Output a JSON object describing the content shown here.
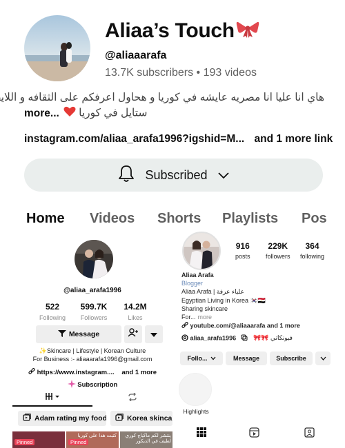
{
  "youtube": {
    "channel_name": "Aliaa’s Touch",
    "handle": "@aliaaarafa",
    "subscribers": "13.7K subscribers",
    "separator": "•",
    "videos": "193 videos",
    "description_line1": "هاي انا عليا انا مصريه عايشه في كوريا و هحاول اعرفكم على الثقافه و اللايف",
    "description_more": "more...",
    "description_line2": "ستايل في كوريا",
    "link_text": "instagram.com/aliaa_arafa1996?igshid=M...",
    "more_links": "and 1 more link",
    "subscribed_label": "Subscribed",
    "tabs": [
      "Home",
      "Videos",
      "Shorts",
      "Playlists",
      "Pos"
    ]
  },
  "tiktok": {
    "handle": "@aliaa_arafa1996",
    "stats": [
      {
        "value": "522",
        "label": "Following"
      },
      {
        "value": "599.7K",
        "label": "Followers"
      },
      {
        "value": "14.2M",
        "label": "Likes"
      }
    ],
    "message_label": "Message",
    "bio_line1": "✨Skincare | Lifestyle | Korean Culture",
    "bio_line2": "For Business :- aliaaarafa1996@gmail.com",
    "link": "https://www.instagram....",
    "more_links": "and 1 more",
    "subscription_label": "Subscription",
    "playlists": [
      "Adam rating my food",
      "Korea skincare"
    ],
    "thumb_pinned": "Pinned",
    "thumb_text_2": "كتبت هذا على كوريا",
    "thumb_text_3": "ينتشر لكم ماكياج كوري لطيف في الديكور"
  },
  "instagram": {
    "stats": [
      {
        "value": "916",
        "label": "posts"
      },
      {
        "value": "229K",
        "label": "followers"
      },
      {
        "value": "364",
        "label": "following"
      }
    ],
    "name": "Aliaa Arafa",
    "category": "Blogger",
    "bio_line1": "Aliaa Arafa | علياء عرفة",
    "bio_line2": "Egyptian Living in Korea 🇰🇷🇪🇬",
    "bio_line3": "Sharing skincare",
    "bio_line4": "For...",
    "bio_more": "more",
    "link": "youtube.com/@aliaaarafa and 1 more",
    "threads_handle": "aliaa_arafa1996",
    "threads_extra": "🎀🎀 فيونكاتي",
    "buttons": [
      "Follo...",
      "Message",
      "Subscribe"
    ],
    "highlights_label": "Highlights"
  },
  "colors": {
    "subscribed_bg": "#eaeeed",
    "bow": "#e2484f",
    "heart": "#e53935",
    "tt_pinned": "#ea4359",
    "ig_category": "#6a8ab8"
  },
  "icons": [
    "bell-icon",
    "chevron-down-icon",
    "bow-icon",
    "heart-icon",
    "filter-icon",
    "add-friend-icon",
    "link-icon",
    "sparkle-icon",
    "grid-icon",
    "repost-icon",
    "playlist-icon",
    "threads-icon",
    "reels-icon",
    "tagged-icon",
    "person-add-icon"
  ]
}
